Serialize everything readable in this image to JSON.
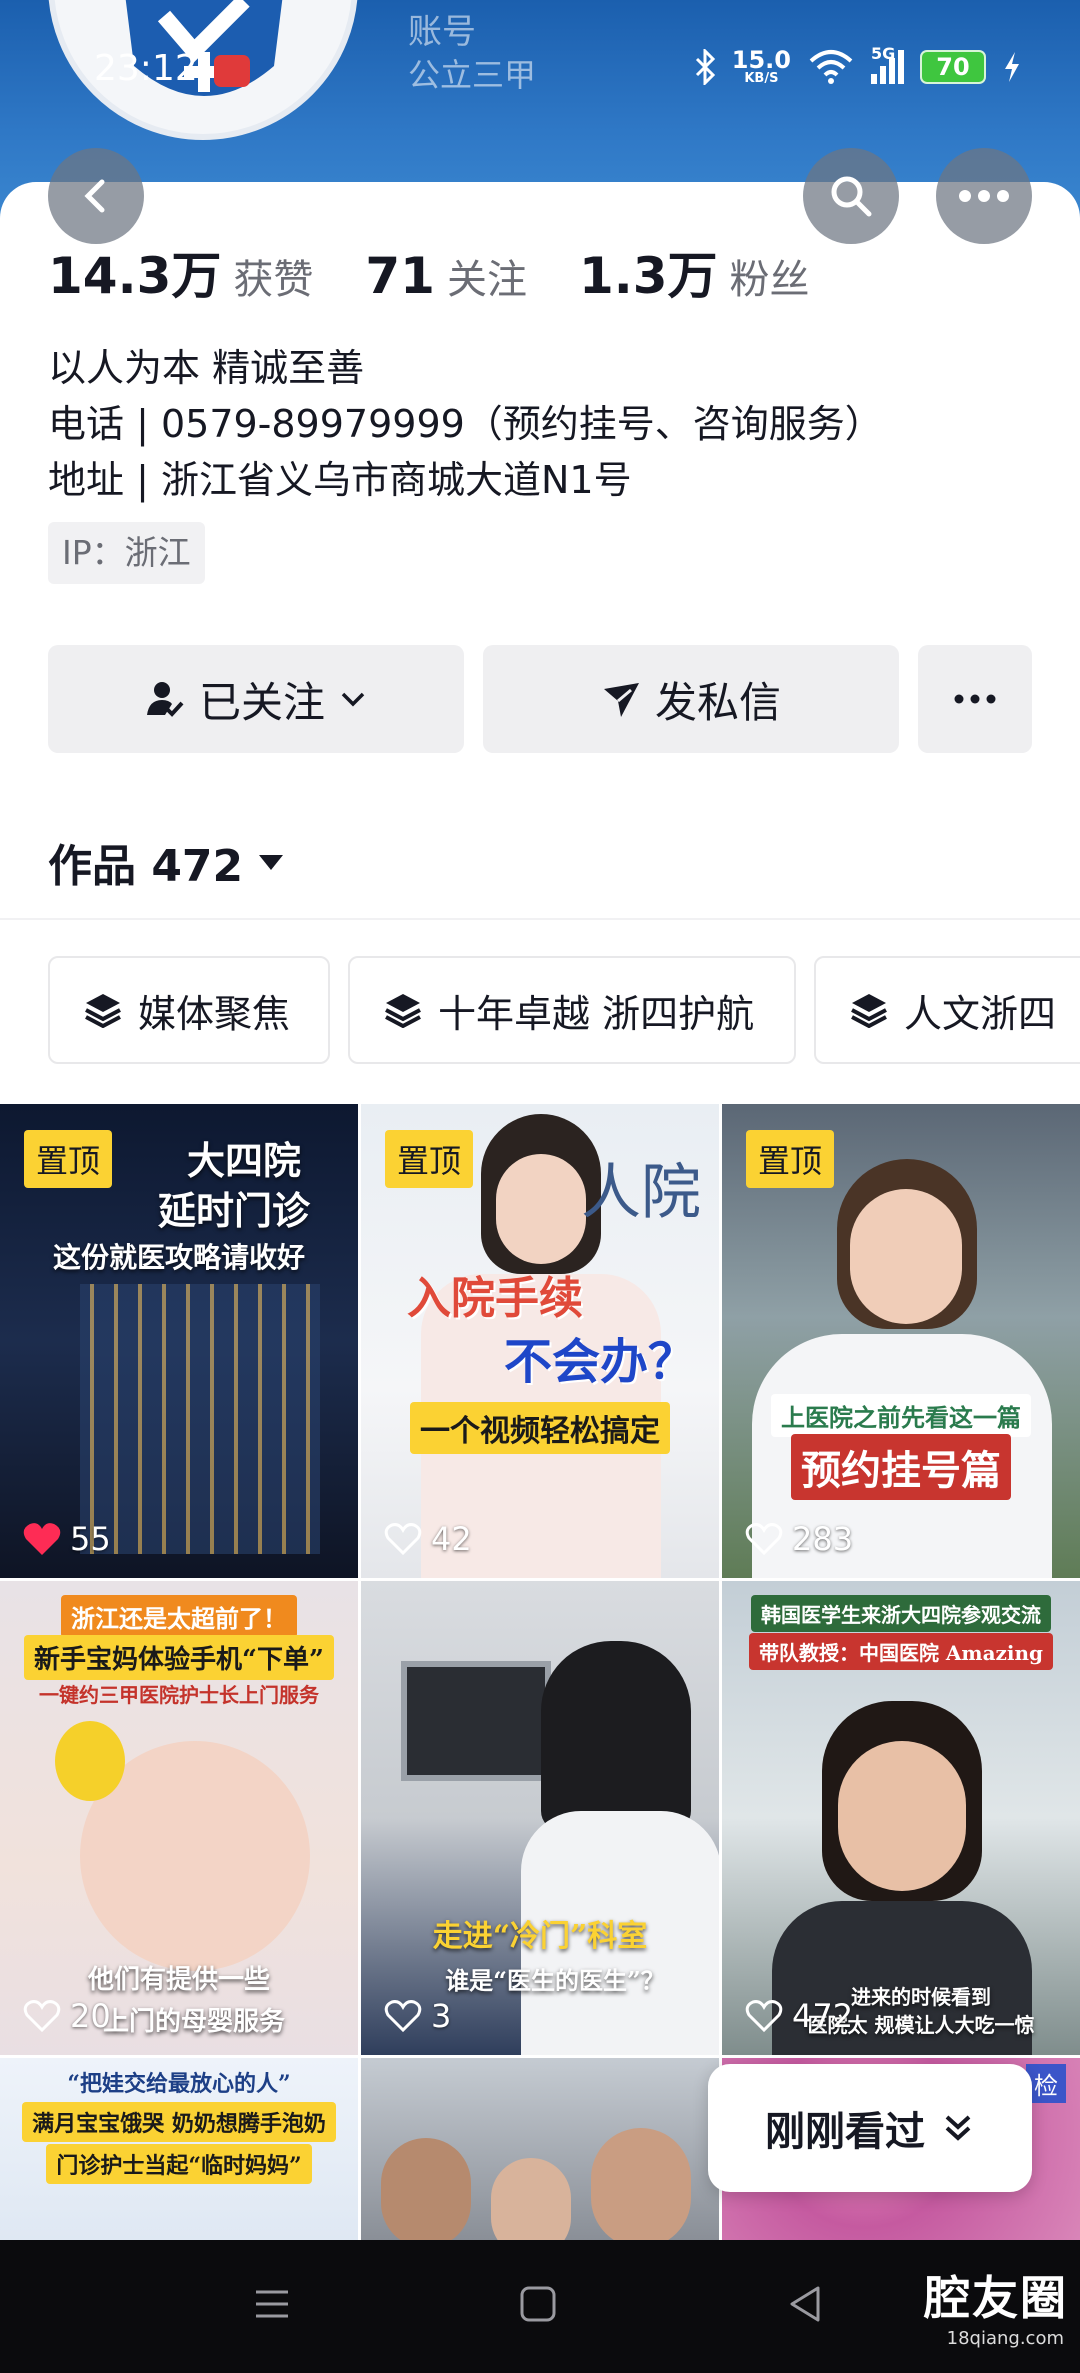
{
  "status_bar": {
    "time": "23:12",
    "net_speed": "15.0",
    "net_unit": "KB/S",
    "signal": "5G",
    "battery": "70"
  },
  "header": {
    "account_label": "账号",
    "tagline": "公立三甲"
  },
  "stats": [
    {
      "value": "14.3万",
      "label": "获赞"
    },
    {
      "value": "71",
      "label": "关注"
    },
    {
      "value": "1.3万",
      "label": "粉丝"
    }
  ],
  "bio": {
    "motto": "以人为本 精诚至善",
    "phone": "电话 | 0579-89979999（预约挂号、咨询服务）",
    "address": "地址 | 浙江省义乌市商城大道N1号"
  },
  "ip": "IP：浙江",
  "actions": {
    "follow": "已关注",
    "message": "发私信"
  },
  "works": {
    "label": "作品 472"
  },
  "collections": [
    "媒体聚焦",
    "十年卓越 浙四护航",
    "人文浙四"
  ],
  "videos": [
    {
      "pinned": "置顶",
      "likes": "55",
      "liked": true,
      "caption_top": "大四院",
      "caption_mid": "延时门诊",
      "caption_sub": "这份就医攻略请收好"
    },
    {
      "pinned": "置顶",
      "likes": "42",
      "liked": false,
      "caption_top": "入院手续",
      "caption_mid": "不会办？",
      "caption_sub": "一个视频轻松搞定"
    },
    {
      "pinned": "置顶",
      "likes": "283",
      "liked": false,
      "caption_top": "上医院之前先看这一篇",
      "caption_mid": "预约挂号篇"
    },
    {
      "likes": "20",
      "liked": false,
      "caption_top": "浙江还是太超前了！",
      "caption_mid": "新手宝妈体验手机“下单”",
      "caption_sub": "一键约三甲医院护士长上门服务",
      "caption_bottom": "他们有提供一些",
      "caption_bottom2": "上门的母婴服务"
    },
    {
      "likes": "3",
      "liked": false,
      "caption_mid": "走进“冷门”科室",
      "caption_sub": "谁是“医生的医生”？"
    },
    {
      "likes": "472",
      "liked": false,
      "caption_top": "韩国医学生来浙大四院参观交流",
      "caption_mid": "带队教授：中国医院 Amazing",
      "caption_bottom": "进来的时候看到",
      "caption_bottom2": "医院太 规模让人大吃一惊"
    },
    {
      "caption_top": "“把娃交给最放心的人”",
      "caption_mid": "满月宝宝饿哭 奶奶想腾手泡奶",
      "caption_sub": "门诊护士当起“临时妈妈”"
    },
    {},
    {
      "caption_top": "检"
    }
  ],
  "recently_viewed": "刚刚看过",
  "watermark": {
    "main": "腔友圈",
    "sub": "18qiang.com"
  },
  "colors": {
    "header_blue": "#2f78c6",
    "pin_yellow": "#fbd233",
    "like_red": "#fe2c55"
  }
}
